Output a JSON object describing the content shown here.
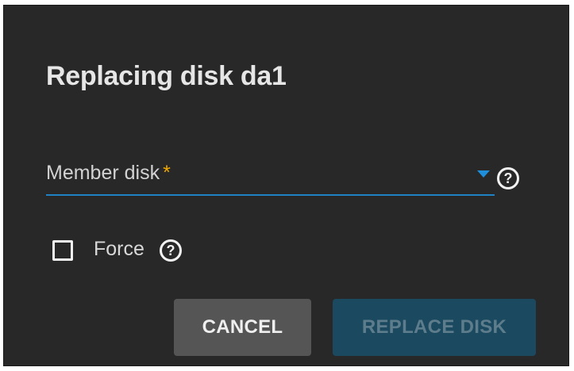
{
  "dialog": {
    "title": "Replacing disk da1",
    "member_disk": {
      "label": "Member disk",
      "required_mark": "*",
      "selected_value": "",
      "help_icon": "?"
    },
    "force": {
      "label": "Force",
      "checked": false,
      "help_icon": "?"
    },
    "actions": {
      "cancel_label": "CANCEL",
      "replace_label": "REPLACE DISK"
    }
  },
  "icons": {
    "dropdown": "caret-down-icon",
    "help": "help-circle-icon",
    "checkbox": "checkbox-unchecked-icon"
  },
  "colors": {
    "dialog_background": "#282828",
    "accent": "#1e82c4",
    "required": "#f0a800",
    "cancel_background": "#555555",
    "replace_background_disabled": "#1b4960"
  }
}
